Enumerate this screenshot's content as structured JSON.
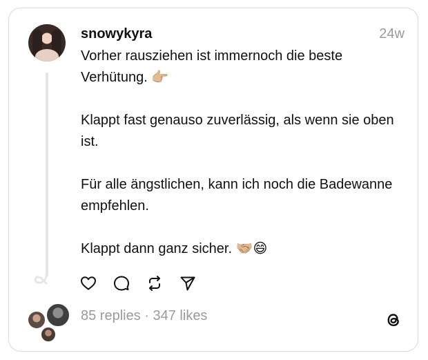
{
  "post": {
    "username": "snowykyra",
    "timestamp": "24w",
    "paragraphs": [
      "Vorher rausziehen ist immernoch die beste Verhütung. 👉🏼",
      "Klappt fast genauso zuverlässig, als wenn sie oben ist.",
      "Für alle ängstlichen, kann ich noch die Badewanne empfehlen.",
      "Klappt dann ganz sicher. 🤝🏼😄"
    ]
  },
  "actions": {
    "like_icon": "heart-icon",
    "reply_icon": "comment-icon",
    "repost_icon": "repost-icon",
    "share_icon": "send-icon"
  },
  "stats": {
    "replies": "85 replies",
    "separator": " · ",
    "likes": "347 likes"
  },
  "brand": {
    "icon": "threads-logo-icon",
    "color": "#101010"
  }
}
